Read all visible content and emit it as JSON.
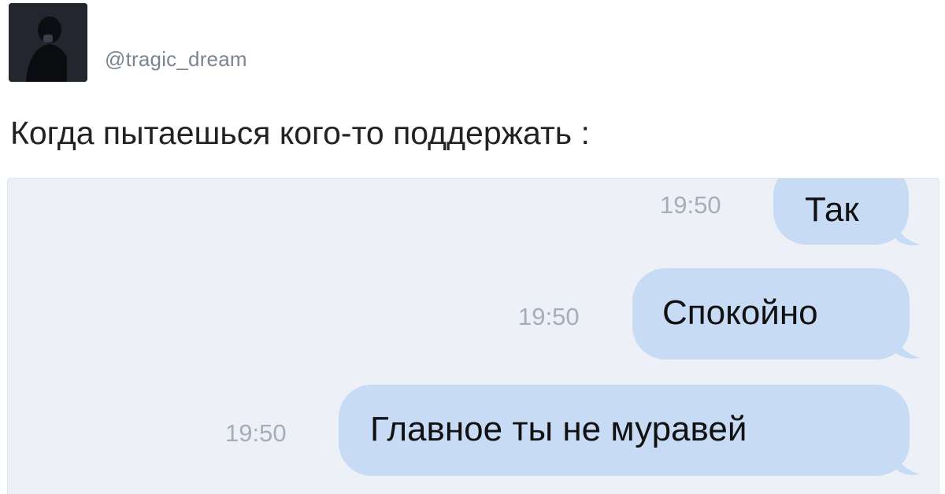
{
  "post": {
    "handle": "@tragic_dream",
    "text": "Когда пытаешься кого-то поддержать :"
  },
  "chat": {
    "messages": [
      {
        "text": "Так",
        "time": "19:50"
      },
      {
        "text": "Спокойно",
        "time": "19:50"
      },
      {
        "text": "Главное ты не муравей",
        "time": "19:50"
      }
    ]
  },
  "colors": {
    "bubble": "#c7dbf4",
    "chat_background": "#edf1f7",
    "timestamp": "#a4adba",
    "handle": "#7a8591"
  }
}
